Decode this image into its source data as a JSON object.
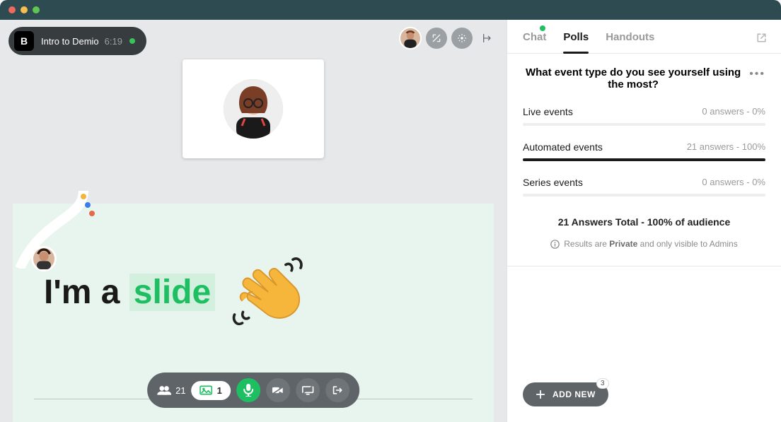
{
  "window": {
    "dot_red": "#ec6a5e",
    "dot_yellow": "#f5bf4f",
    "dot_green": "#61c554"
  },
  "header": {
    "badge": "B",
    "title": "Intro to Demio",
    "time": "6:19",
    "live": true
  },
  "slide": {
    "text_pre": "I'm a ",
    "text_em": "slide"
  },
  "controls": {
    "attendees_count": "21",
    "media_count": "1"
  },
  "sidebar": {
    "tabs": {
      "chat": "Chat",
      "polls": "Polls",
      "handouts": "Handouts"
    },
    "poll": {
      "question": "What event type do you see yourself using the most?",
      "options": [
        {
          "label": "Live events",
          "answers": "0 answers",
          "pct": "0%",
          "fill": 0
        },
        {
          "label": "Automated events",
          "answers": "21 answers",
          "pct": "100%",
          "fill": 100
        },
        {
          "label": "Series events",
          "answers": "0 answers",
          "pct": "0%",
          "fill": 0
        }
      ],
      "summary": "21 Answers Total - 100% of audience",
      "note_pre": "Results are ",
      "note_strong": "Private",
      "note_post": " and only visible to Admins"
    },
    "add_new": {
      "label": "ADD NEW",
      "badge": "3"
    }
  }
}
